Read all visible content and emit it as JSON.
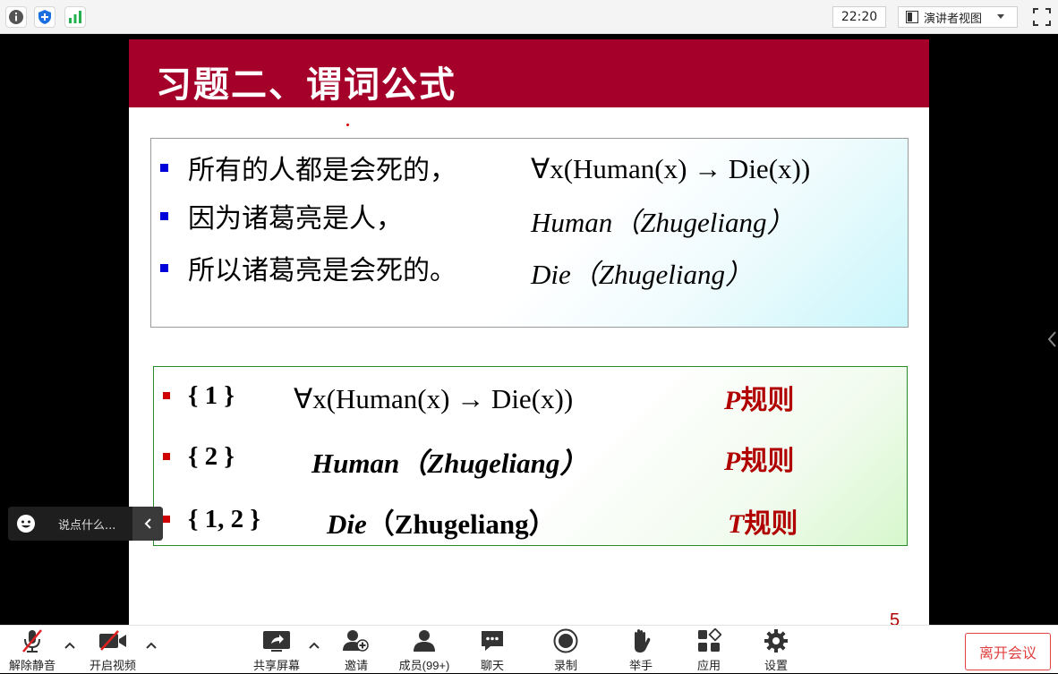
{
  "topbar": {
    "icons": [
      "info-icon",
      "shield-icon",
      "signal-icon"
    ],
    "clock": "22:20",
    "view_select": "演讲者视图",
    "fullscreen_icon": "fullscreen-icon"
  },
  "slide": {
    "title": "习题二、谓词公式",
    "box1": [
      {
        "text": "所有的人都是会死的，",
        "formula": "∀x(Human(x) → Die(x))"
      },
      {
        "text": "因为诸葛亮是人，",
        "formula": "Human（Zhugeliang）"
      },
      {
        "text": "所以诸葛亮是会死的。",
        "formula": "Die（Zhugeliang）"
      }
    ],
    "box2": [
      {
        "step": "{ 1 }",
        "formula": "∀x(Human(x) → Die(x))",
        "rule_letter": "P",
        "rule_word": "规则"
      },
      {
        "step": "{ 2 }",
        "formula_italic": "Human",
        "formula_rest": "（Zhugeliang）",
        "rule_letter": "P",
        "rule_word": "规则"
      },
      {
        "step": "{ 1, 2 }",
        "formula_italic": "Die",
        "formula_rest": "（Zhugeliang）",
        "rule_letter": "T",
        "rule_word": "规则"
      }
    ],
    "page_number": "5"
  },
  "chat": {
    "placeholder": "说点什么..."
  },
  "toolbar": {
    "unmute": "解除静音",
    "start_video": "开启视频",
    "share_screen": "共享屏幕",
    "invite": "邀请",
    "members": "成员(99+)",
    "chat": "聊天",
    "record": "录制",
    "raise_hand": "举手",
    "apps": "应用",
    "settings": "设置",
    "leave": "离开会议"
  },
  "colors": {
    "slide_header": "#a5002a",
    "rule_red": "#b00000",
    "bullet_blue": "#0000d8",
    "bullet_red": "#d00000",
    "leave_red": "#e04040"
  }
}
